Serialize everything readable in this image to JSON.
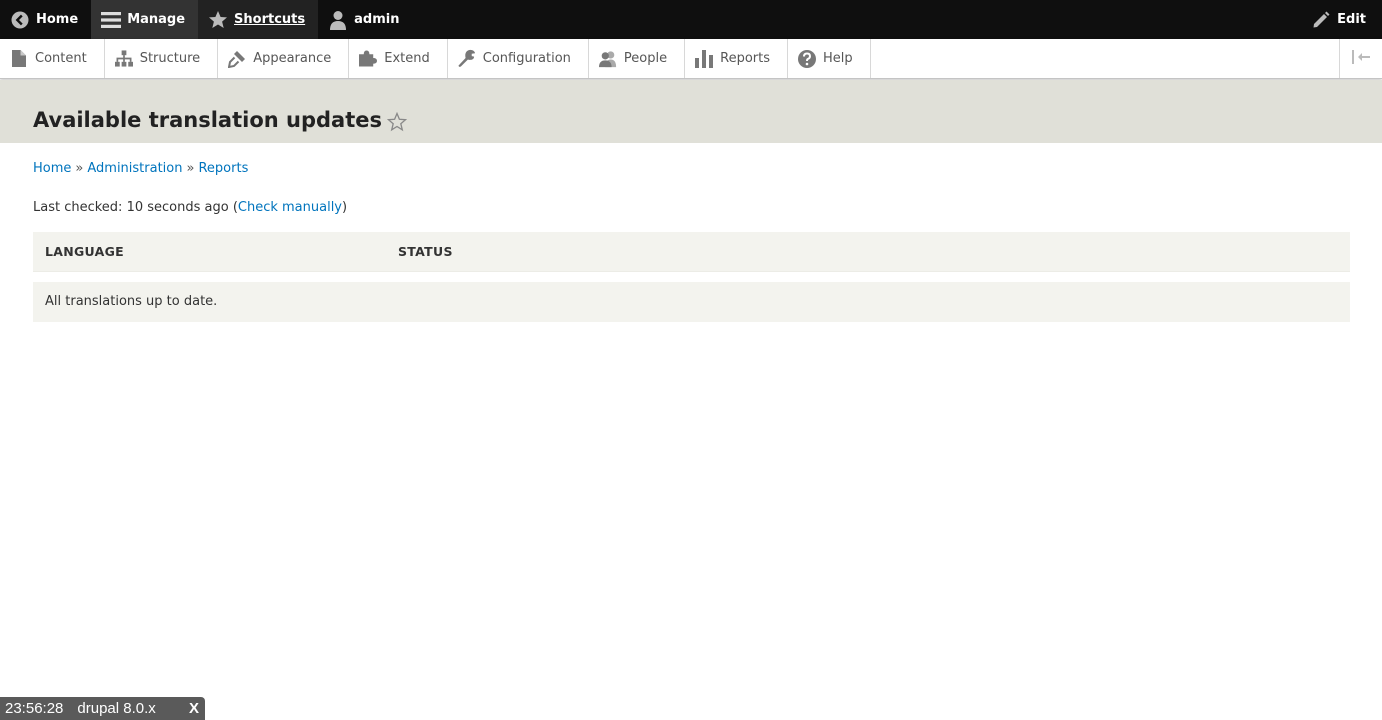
{
  "toolbar": {
    "home_label": "Home",
    "manage_label": "Manage",
    "shortcuts_label": "Shortcuts",
    "user_label": "admin",
    "edit_label": "Edit"
  },
  "tray": {
    "items": [
      {
        "label": "Content",
        "icon": "file-icon"
      },
      {
        "label": "Structure",
        "icon": "sitemap-icon"
      },
      {
        "label": "Appearance",
        "icon": "paintbrush-icon"
      },
      {
        "label": "Extend",
        "icon": "puzzle-icon"
      },
      {
        "label": "Configuration",
        "icon": "wrench-icon"
      },
      {
        "label": "People",
        "icon": "people-icon"
      },
      {
        "label": "Reports",
        "icon": "bar-chart-icon"
      },
      {
        "label": "Help",
        "icon": "question-icon"
      }
    ]
  },
  "page": {
    "title": "Available translation updates"
  },
  "breadcrumb": {
    "items": [
      "Home",
      "Administration",
      "Reports"
    ],
    "separator": "»"
  },
  "status": {
    "last_checked_prefix": "Last checked: 10 seconds ago (",
    "check_manually_label": "Check manually",
    "last_checked_suffix": ")"
  },
  "table": {
    "headers": [
      "LANGUAGE",
      "STATUS"
    ],
    "empty_message": "All translations up to date."
  },
  "overlay": {
    "time": "23:56:28",
    "label": "drupal 8.0.x",
    "close": "X"
  },
  "colors": {
    "toolbar_bg": "#0f0f0f",
    "link": "#0074bd",
    "header_band": "#e0e0d8",
    "table_bg": "#f3f3ee"
  }
}
